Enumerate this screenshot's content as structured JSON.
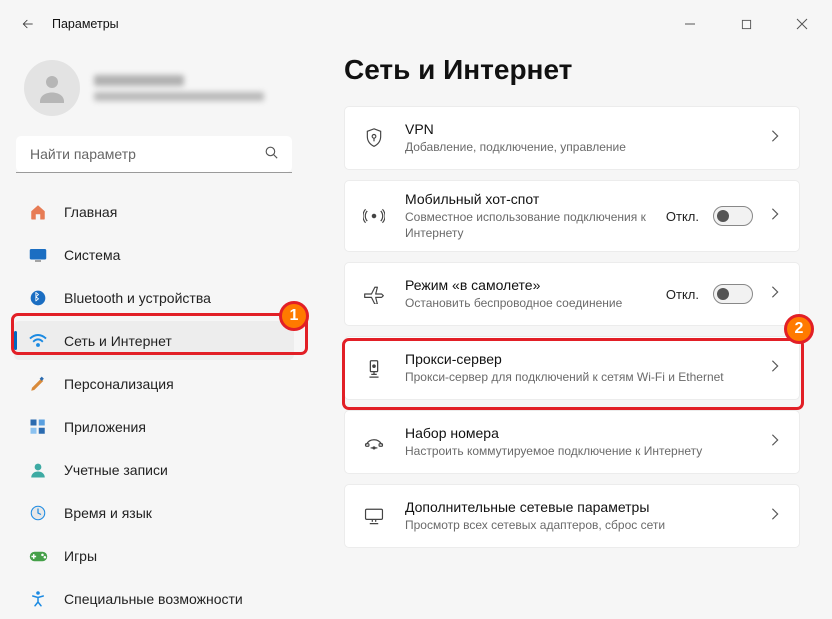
{
  "window": {
    "title": "Параметры"
  },
  "search": {
    "placeholder": "Найти параметр"
  },
  "nav": {
    "items": [
      {
        "label": "Главная"
      },
      {
        "label": "Система"
      },
      {
        "label": "Bluetooth и устройства"
      },
      {
        "label": "Сеть и Интернет"
      },
      {
        "label": "Персонализация"
      },
      {
        "label": "Приложения"
      },
      {
        "label": "Учетные записи"
      },
      {
        "label": "Время и язык"
      },
      {
        "label": "Игры"
      },
      {
        "label": "Специальные возможности"
      }
    ]
  },
  "page": {
    "title": "Сеть и Интернет"
  },
  "cards": [
    {
      "title": "VPN",
      "subtitle": "Добавление, подключение, управление"
    },
    {
      "title": "Мобильный хот-спот",
      "subtitle": "Совместное использование подключения к Интернету",
      "status": "Откл."
    },
    {
      "title": "Режим «в самолете»",
      "subtitle": "Остановить беспроводное соединение",
      "status": "Откл."
    },
    {
      "title": "Прокси-сервер",
      "subtitle": "Прокси-сервер для подключений к сетям Wi-Fi и Ethernet"
    },
    {
      "title": "Набор номера",
      "subtitle": "Настроить коммутируемое подключение к Интернету"
    },
    {
      "title": "Дополнительные сетевые параметры",
      "subtitle": "Просмотр всех сетевых адаптеров, сброс сети"
    }
  ],
  "annotations": {
    "badge1": "1",
    "badge2": "2"
  }
}
